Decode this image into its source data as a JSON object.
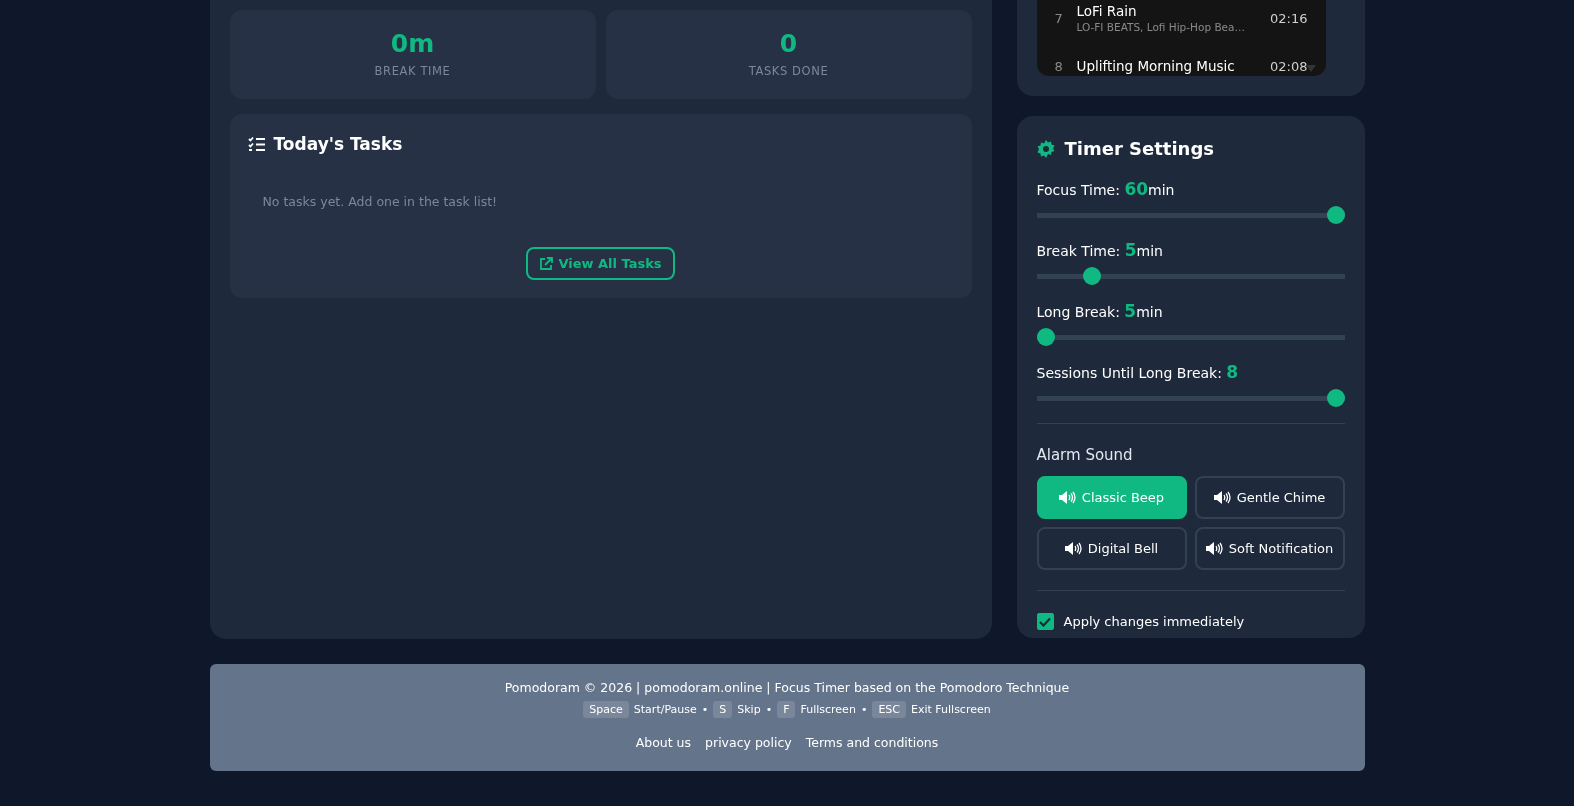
{
  "stats": [
    {
      "value": "0m",
      "label": "BREAK TIME"
    },
    {
      "value": "0",
      "label": "TASKS DONE"
    }
  ],
  "tasks": {
    "title": "Today's Tasks",
    "empty": "No tasks yet. Add one in the task list!",
    "button": "View All Tasks"
  },
  "playlist": {
    "tracks": [
      {
        "number": "7",
        "title": "LoFi Rain",
        "artist": "LO-FI BEATS, Lofi Hip-Hop Bea…",
        "duration": "02:16"
      },
      {
        "number": "8",
        "title": "Uplifting Morning Music",
        "duration": "02:08"
      }
    ]
  },
  "settings": {
    "title": "Timer Settings",
    "sliders": [
      {
        "label": "Focus Time:",
        "value": "60",
        "unit": "min",
        "level": 1
      },
      {
        "label": "Break Time:",
        "value": "5",
        "unit": "min",
        "level": 0.16
      },
      {
        "label": "Long Break:",
        "value": "5",
        "unit": "min",
        "level": 0
      },
      {
        "label": "Sessions Until Long Break:",
        "value": "8",
        "level": 1
      }
    ],
    "alarm": {
      "label": "Alarm Sound",
      "options": [
        {
          "label": "Classic Beep",
          "selected": true
        },
        {
          "label": "Gentle Chime",
          "selected": false
        },
        {
          "label": "Digital Bell",
          "selected": false
        },
        {
          "label": "Soft Notification",
          "selected": false
        }
      ]
    },
    "apply": {
      "label": "Apply changes immediately",
      "checked": true
    }
  },
  "footer": {
    "line": "Pomodoram © 2026 | pomodoram.online | Focus Timer based on the Pomodoro Technique",
    "separator": "•",
    "shortcuts": [
      {
        "key": "Space",
        "action": "Start/Pause"
      },
      {
        "key": "S",
        "action": "Skip"
      },
      {
        "key": "F",
        "action": "Fullscreen"
      },
      {
        "key": "ESC",
        "action": "Exit Fullscreen"
      }
    ],
    "links": [
      "About us",
      "privacy policy",
      "Terms and conditions"
    ]
  }
}
